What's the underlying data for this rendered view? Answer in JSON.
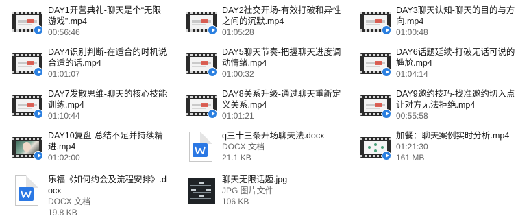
{
  "files": [
    {
      "title": "DAY1开营典礼-聊天是个“无限游戏”.mp4",
      "meta1": "00:56:46",
      "meta2": "",
      "icon": "video-thumbnail-icon"
    },
    {
      "title": "DAY2社交开场-有效打破和异性之间的沉默.mp4",
      "meta1": "01:05:28",
      "meta2": "",
      "icon": "video-thumbnail-icon"
    },
    {
      "title": "DAY3聊天认知-聊天的目的与方向.mp4",
      "meta1": "01:00:48",
      "meta2": "",
      "icon": "video-thumbnail-icon"
    },
    {
      "title": "DAY4识别判断-在适合的时机说合适的话.mp4",
      "meta1": "01:01:07",
      "meta2": "",
      "icon": "video-thumbnail-icon"
    },
    {
      "title": "DAY5聊天节奏-把握聊天进度调动情绪.mp4",
      "meta1": "01:00:32",
      "meta2": "",
      "icon": "video-thumbnail-icon"
    },
    {
      "title": "DAY6话题延续-打破无话可说的尴尬.mp4",
      "meta1": "01:04:14",
      "meta2": "",
      "icon": "video-thumbnail-icon"
    },
    {
      "title": "DAY7发散思维-聊天的核心技能训练.mp4",
      "meta1": "01:10:44",
      "meta2": "",
      "icon": "video-thumbnail-icon"
    },
    {
      "title": "DAY8关系升级-通过聊天重新定义关系.mp4",
      "meta1": "01:01:21",
      "meta2": "",
      "icon": "video-thumbnail-icon"
    },
    {
      "title": "DAY9邀约技巧-找准邀约切入点让对方无法拒绝.mp4",
      "meta1": "00:55:58",
      "meta2": "",
      "icon": "video-thumbnail-icon"
    },
    {
      "title": "DAY10复盘-总结不足并持续精进.mp4",
      "meta1": "01:02:00",
      "meta2": "",
      "icon": "video-thumbnail-icon"
    },
    {
      "title": "q三十三条开场聊天法.docx",
      "meta1": "DOCX 文档",
      "meta2": "21.1 KB",
      "icon": "word-document-icon"
    },
    {
      "title": "加餐：聊天案例实时分析.mp4",
      "meta1": "01:21:30",
      "meta2": "161 MB",
      "icon": "video-thumbnail-icon"
    },
    {
      "title": "乐福《如何约会及流程安排》.docx",
      "meta1": "DOCX 文档",
      "meta2": "19.8 KB",
      "icon": "word-document-icon"
    },
    {
      "title": "聊天无限话题.jpg",
      "meta1": "JPG 图片文件",
      "meta2": "106 KB",
      "icon": "image-thumbnail-icon"
    }
  ]
}
